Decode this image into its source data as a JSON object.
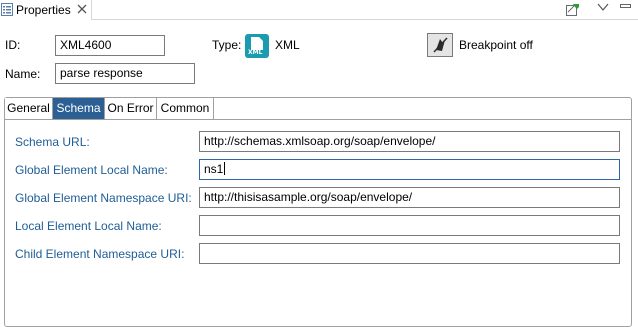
{
  "view": {
    "title": "Properties"
  },
  "header": {
    "id_label": "ID:",
    "id_value": "XML4600",
    "name_label": "Name:",
    "name_value": "parse response",
    "type_label": "Type:",
    "type_value": "XML",
    "type_icon_text": "XML",
    "breakpoint_label": "Breakpoint off"
  },
  "tabs": [
    {
      "label": "General",
      "active": false
    },
    {
      "label": "Schema",
      "active": true
    },
    {
      "label": "On Error",
      "active": false
    },
    {
      "label": "Common",
      "active": false
    }
  ],
  "schema": {
    "fields": [
      {
        "label": "Schema URL:",
        "value": "http://schemas.xmlsoap.org/soap/envelope/"
      },
      {
        "label": "Global Element Local Name:",
        "value": "ns1"
      },
      {
        "label": "Global Element Namespace URI:",
        "value": "http://thisisasample.org/soap/envelope/"
      },
      {
        "label": "Local Element Local Name:",
        "value": ""
      },
      {
        "label": "Child Element Namespace URI:",
        "value": ""
      }
    ]
  },
  "colors": {
    "active_tab": "#2c5f94",
    "field_label": "#1f5d96",
    "type_icon": "#1a9bb0"
  }
}
